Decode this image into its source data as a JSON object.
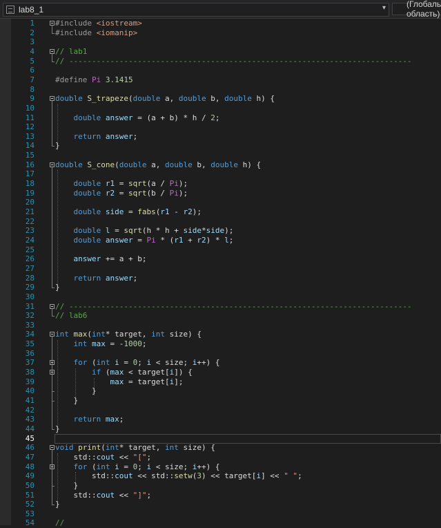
{
  "editor": {
    "file_name": "lab8_1",
    "scope": "(Глобальная область)",
    "current_line": 45
  },
  "colors": {
    "keyword": "#569cd6",
    "function": "#dcdcaa",
    "variable": "#9cdcfe",
    "comment": "#57a64a",
    "string": "#d69d85",
    "number": "#b5cea8",
    "preprocessor": "#9b9b9b",
    "macro": "#bd63c5",
    "line_number": "#2b91af"
  },
  "lines": [
    [
      [
        "pp",
        "#include "
      ],
      [
        "str",
        "<iostream>"
      ]
    ],
    [
      [
        "pp",
        "#include "
      ],
      [
        "str",
        "<iomanip>"
      ]
    ],
    [],
    [
      [
        "cm",
        "// lab1"
      ]
    ],
    [
      [
        "cm",
        "// ---------------------------------------------------------------------------"
      ]
    ],
    [],
    [
      [
        "pp",
        "#define "
      ],
      [
        "pc",
        "Pi"
      ],
      [
        "tx",
        " "
      ],
      [
        "num",
        "3.1415"
      ]
    ],
    [],
    [
      [
        "kw",
        "double"
      ],
      [
        "tx",
        " "
      ],
      [
        "fn",
        "S_trapeze"
      ],
      [
        "tx",
        "("
      ],
      [
        "kw",
        "double"
      ],
      [
        "tx",
        " a, "
      ],
      [
        "kw",
        "double"
      ],
      [
        "tx",
        " b, "
      ],
      [
        "kw",
        "double"
      ],
      [
        "tx",
        " h) {"
      ]
    ],
    [],
    [
      [
        "tx",
        "    "
      ],
      [
        "kw",
        "double"
      ],
      [
        "tx",
        " "
      ],
      [
        "vr",
        "answer"
      ],
      [
        "tx",
        " = (a + b) * h / "
      ],
      [
        "num",
        "2"
      ],
      [
        "tx",
        ";"
      ]
    ],
    [],
    [
      [
        "tx",
        "    "
      ],
      [
        "kw",
        "return"
      ],
      [
        "tx",
        " "
      ],
      [
        "vr",
        "answer"
      ],
      [
        "tx",
        ";"
      ]
    ],
    [
      [
        "tx",
        "}"
      ]
    ],
    [],
    [
      [
        "kw",
        "double"
      ],
      [
        "tx",
        " "
      ],
      [
        "fn",
        "S_cone"
      ],
      [
        "tx",
        "("
      ],
      [
        "kw",
        "double"
      ],
      [
        "tx",
        " a, "
      ],
      [
        "kw",
        "double"
      ],
      [
        "tx",
        " b, "
      ],
      [
        "kw",
        "double"
      ],
      [
        "tx",
        " h) {"
      ]
    ],
    [],
    [
      [
        "tx",
        "    "
      ],
      [
        "kw",
        "double"
      ],
      [
        "tx",
        " "
      ],
      [
        "vr",
        "r1"
      ],
      [
        "tx",
        " = "
      ],
      [
        "fn",
        "sqrt"
      ],
      [
        "tx",
        "(a / "
      ],
      [
        "pc",
        "Pi"
      ],
      [
        "tx",
        ");"
      ]
    ],
    [
      [
        "tx",
        "    "
      ],
      [
        "kw",
        "double"
      ],
      [
        "tx",
        " "
      ],
      [
        "vr",
        "r2"
      ],
      [
        "tx",
        " = "
      ],
      [
        "fn",
        "sqrt"
      ],
      [
        "tx",
        "(b / "
      ],
      [
        "pc",
        "Pi"
      ],
      [
        "tx",
        ");"
      ]
    ],
    [],
    [
      [
        "tx",
        "    "
      ],
      [
        "kw",
        "double"
      ],
      [
        "tx",
        " "
      ],
      [
        "vr",
        "side"
      ],
      [
        "tx",
        " = "
      ],
      [
        "fn",
        "fabs"
      ],
      [
        "tx",
        "("
      ],
      [
        "vr",
        "r1"
      ],
      [
        "tx",
        " - "
      ],
      [
        "vr",
        "r2"
      ],
      [
        "tx",
        ");"
      ]
    ],
    [],
    [
      [
        "tx",
        "    "
      ],
      [
        "kw",
        "double"
      ],
      [
        "tx",
        " "
      ],
      [
        "vr",
        "l"
      ],
      [
        "tx",
        " = "
      ],
      [
        "fn",
        "sqrt"
      ],
      [
        "tx",
        "(h * h + "
      ],
      [
        "vr",
        "side"
      ],
      [
        "tx",
        "*"
      ],
      [
        "vr",
        "side"
      ],
      [
        "tx",
        ");"
      ]
    ],
    [
      [
        "tx",
        "    "
      ],
      [
        "kw",
        "double"
      ],
      [
        "tx",
        " "
      ],
      [
        "vr",
        "answer"
      ],
      [
        "tx",
        " = "
      ],
      [
        "pc",
        "Pi"
      ],
      [
        "tx",
        " * ("
      ],
      [
        "vr",
        "r1"
      ],
      [
        "tx",
        " + "
      ],
      [
        "vr",
        "r2"
      ],
      [
        "tx",
        ") * "
      ],
      [
        "vr",
        "l"
      ],
      [
        "tx",
        ";"
      ]
    ],
    [],
    [
      [
        "tx",
        "    "
      ],
      [
        "vr",
        "answer"
      ],
      [
        "tx",
        " += a + b;"
      ]
    ],
    [],
    [
      [
        "tx",
        "    "
      ],
      [
        "kw",
        "return"
      ],
      [
        "tx",
        " "
      ],
      [
        "vr",
        "answer"
      ],
      [
        "tx",
        ";"
      ]
    ],
    [
      [
        "tx",
        "}"
      ]
    ],
    [],
    [
      [
        "cm",
        "// ---------------------------------------------------------------------------"
      ]
    ],
    [
      [
        "cm",
        "// lab6"
      ]
    ],
    [],
    [
      [
        "kw",
        "int"
      ],
      [
        "tx",
        " "
      ],
      [
        "fn",
        "max"
      ],
      [
        "tx",
        "("
      ],
      [
        "kw",
        "int"
      ],
      [
        "tx",
        "* target, "
      ],
      [
        "kw",
        "int"
      ],
      [
        "tx",
        " size) {"
      ]
    ],
    [
      [
        "tx",
        "    "
      ],
      [
        "kw",
        "int"
      ],
      [
        "tx",
        " "
      ],
      [
        "vr",
        "max"
      ],
      [
        "tx",
        " = -"
      ],
      [
        "num",
        "1000"
      ],
      [
        "tx",
        ";"
      ]
    ],
    [],
    [
      [
        "tx",
        "    "
      ],
      [
        "kw",
        "for"
      ],
      [
        "tx",
        " ("
      ],
      [
        "kw",
        "int"
      ],
      [
        "tx",
        " "
      ],
      [
        "vr",
        "i"
      ],
      [
        "tx",
        " = "
      ],
      [
        "num",
        "0"
      ],
      [
        "tx",
        "; "
      ],
      [
        "vr",
        "i"
      ],
      [
        "tx",
        " < size; "
      ],
      [
        "vr",
        "i"
      ],
      [
        "tx",
        "++) {"
      ]
    ],
    [
      [
        "tx",
        "        "
      ],
      [
        "kw",
        "if"
      ],
      [
        "tx",
        " ("
      ],
      [
        "vr",
        "max"
      ],
      [
        "tx",
        " < target["
      ],
      [
        "vr",
        "i"
      ],
      [
        "tx",
        "]) {"
      ]
    ],
    [
      [
        "tx",
        "            "
      ],
      [
        "vr",
        "max"
      ],
      [
        "tx",
        " = target["
      ],
      [
        "vr",
        "i"
      ],
      [
        "tx",
        "];"
      ]
    ],
    [
      [
        "tx",
        "        }"
      ]
    ],
    [
      [
        "tx",
        "    }"
      ]
    ],
    [],
    [
      [
        "tx",
        "    "
      ],
      [
        "kw",
        "return"
      ],
      [
        "tx",
        " "
      ],
      [
        "vr",
        "max"
      ],
      [
        "tx",
        ";"
      ]
    ],
    [
      [
        "tx",
        "}"
      ]
    ],
    [],
    [
      [
        "kw",
        "void"
      ],
      [
        "tx",
        " "
      ],
      [
        "fn",
        "print"
      ],
      [
        "tx",
        "("
      ],
      [
        "kw",
        "int"
      ],
      [
        "tx",
        "* target, "
      ],
      [
        "kw",
        "int"
      ],
      [
        "tx",
        " size) {"
      ]
    ],
    [
      [
        "tx",
        "    std::"
      ],
      [
        "vr",
        "cout"
      ],
      [
        "tx",
        " << "
      ],
      [
        "str",
        "\"[\""
      ],
      [
        "tx",
        ";"
      ]
    ],
    [
      [
        "tx",
        "    "
      ],
      [
        "kw",
        "for"
      ],
      [
        "tx",
        " ("
      ],
      [
        "kw",
        "int"
      ],
      [
        "tx",
        " "
      ],
      [
        "vr",
        "i"
      ],
      [
        "tx",
        " = "
      ],
      [
        "num",
        "0"
      ],
      [
        "tx",
        "; "
      ],
      [
        "vr",
        "i"
      ],
      [
        "tx",
        " < size; "
      ],
      [
        "vr",
        "i"
      ],
      [
        "tx",
        "++) {"
      ]
    ],
    [
      [
        "tx",
        "        std::"
      ],
      [
        "vr",
        "cout"
      ],
      [
        "tx",
        " << std::"
      ],
      [
        "fn",
        "setw"
      ],
      [
        "tx",
        "("
      ],
      [
        "num",
        "3"
      ],
      [
        "tx",
        ") << target["
      ],
      [
        "vr",
        "i"
      ],
      [
        "tx",
        "] << "
      ],
      [
        "str",
        "\" \""
      ],
      [
        "tx",
        ";"
      ]
    ],
    [
      [
        "tx",
        "    }"
      ]
    ],
    [
      [
        "tx",
        "    std::"
      ],
      [
        "vr",
        "cout"
      ],
      [
        "tx",
        " << "
      ],
      [
        "str",
        "\"]\""
      ],
      [
        "tx",
        ";"
      ]
    ],
    [
      [
        "tx",
        "}"
      ]
    ],
    [],
    [
      [
        "cm",
        "//"
      ]
    ]
  ],
  "folds": [
    1,
    4,
    9,
    16,
    31,
    34,
    37,
    38,
    46,
    48
  ],
  "fold_ranges": [
    [
      1,
      2
    ],
    [
      4,
      5
    ],
    [
      9,
      14
    ],
    [
      16,
      29
    ],
    [
      31,
      32
    ],
    [
      34,
      44
    ],
    [
      37,
      41
    ],
    [
      38,
      40
    ],
    [
      46,
      52
    ],
    [
      48,
      50
    ]
  ],
  "guides": [
    [
      0,
      9,
      14
    ],
    [
      0,
      16,
      29
    ],
    [
      0,
      34,
      44
    ],
    [
      1,
      37,
      41
    ],
    [
      2,
      38,
      40
    ],
    [
      0,
      46,
      52
    ],
    [
      1,
      48,
      50
    ]
  ]
}
